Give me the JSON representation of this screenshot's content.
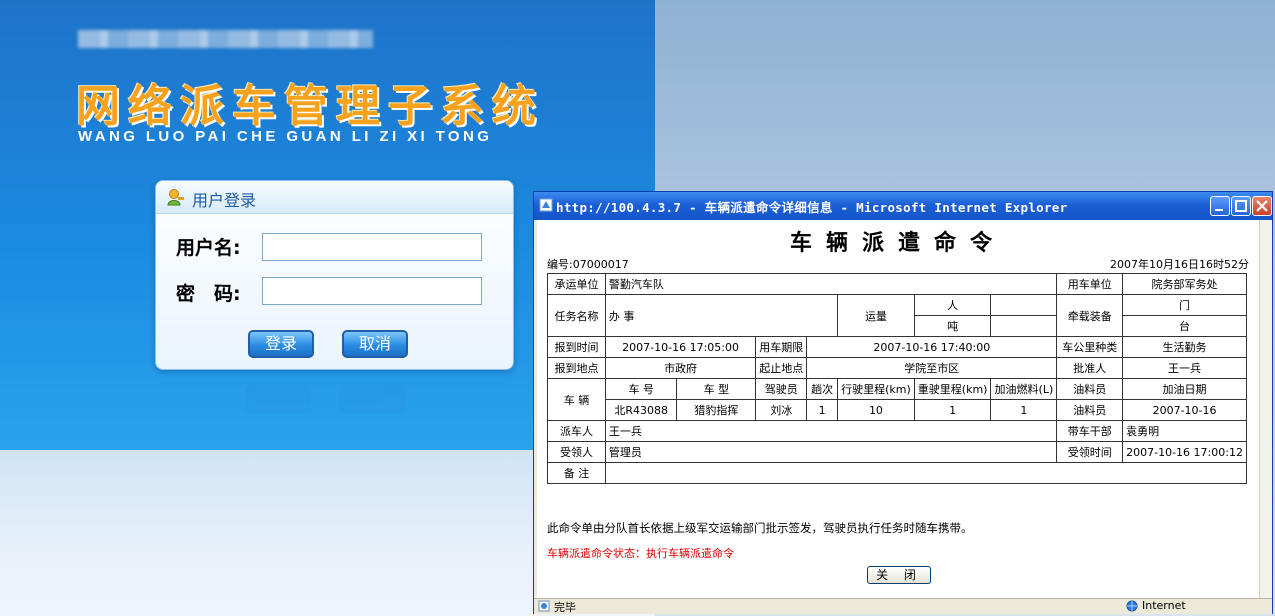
{
  "login_page": {
    "title": "网络派车管理子系统",
    "pinyin": "WANG LUO PAI CHE GUAN LI ZI XI TONG",
    "login_box": {
      "header": "用户登录",
      "username_label": "用户名:",
      "password_label": "密　码:",
      "username_value": "",
      "password_value": "",
      "login_button": "登录",
      "cancel_button": "取消"
    }
  },
  "ie_window": {
    "title": "http://100.4.3.7 - 车辆派遣命令详细信息 - Microsoft Internet Explorer",
    "status_left": "完毕",
    "status_right": "Internet"
  },
  "order": {
    "title": "车辆派遣命令",
    "number": "编号:07000017",
    "date": "2007年10月16日16时52分",
    "labels": {
      "carrier": "承运单位",
      "user_unit": "用车单位",
      "task": "任务名称",
      "volume": "运量",
      "person": "人",
      "ton": "吨",
      "equipment": "牵载装备",
      "door": "门",
      "set": "台",
      "report_time": "报到时间",
      "period": "用车期限",
      "vehicle_type": "车公里种类",
      "report_place": "报到地点",
      "route": "起止地点",
      "approver": "批准人",
      "vehicle": "车 辆",
      "plate_no": "车 号",
      "model": "车 型",
      "driver": "驾驶员",
      "trips": "趟次",
      "km": "行驶里程(km)",
      "empty_km": "重驶里程(km)",
      "fuel": "加油燃料(L)",
      "fueler": "油料员",
      "fuel_date": "加油日期",
      "dispatcher": "派车人",
      "cadre": "带车干部",
      "receiver": "受领人",
      "receive_time": "受领时间",
      "remarks": "备 注"
    },
    "values": {
      "carrier": "警勤汽车队",
      "user_unit": "院务部军务处",
      "task": "办 事",
      "report_time": "2007-10-16 17:05:00",
      "period": "2007-10-16 17:40:00",
      "vehicle_type": "生活勤务",
      "report_place": "市政府",
      "route": "学院至市区",
      "approver": "王一兵",
      "plate_no": "北R43088",
      "model": "猎豹指挥",
      "driver": "刘冰",
      "trips": "1",
      "km": "10",
      "empty_km": "1",
      "fuel": "1",
      "fueler": "油料员",
      "fuel_date": "2007-10-16",
      "dispatcher": "王一兵",
      "cadre": "袁勇明",
      "receiver": "管理员",
      "receive_time": "2007-10-16 17:00:12",
      "remarks": ""
    },
    "note": "此命令单由分队首长依据上级军交运输部门批示签发，驾驶员执行任务时随车携带。",
    "state": "车辆派遣命令状态：执行车辆派遣命令",
    "close_button": "关 闭"
  },
  "colors": {
    "title_orange": "#f6a21e",
    "xp_blue": "#1b5fd6",
    "state_red": "#e00000"
  }
}
